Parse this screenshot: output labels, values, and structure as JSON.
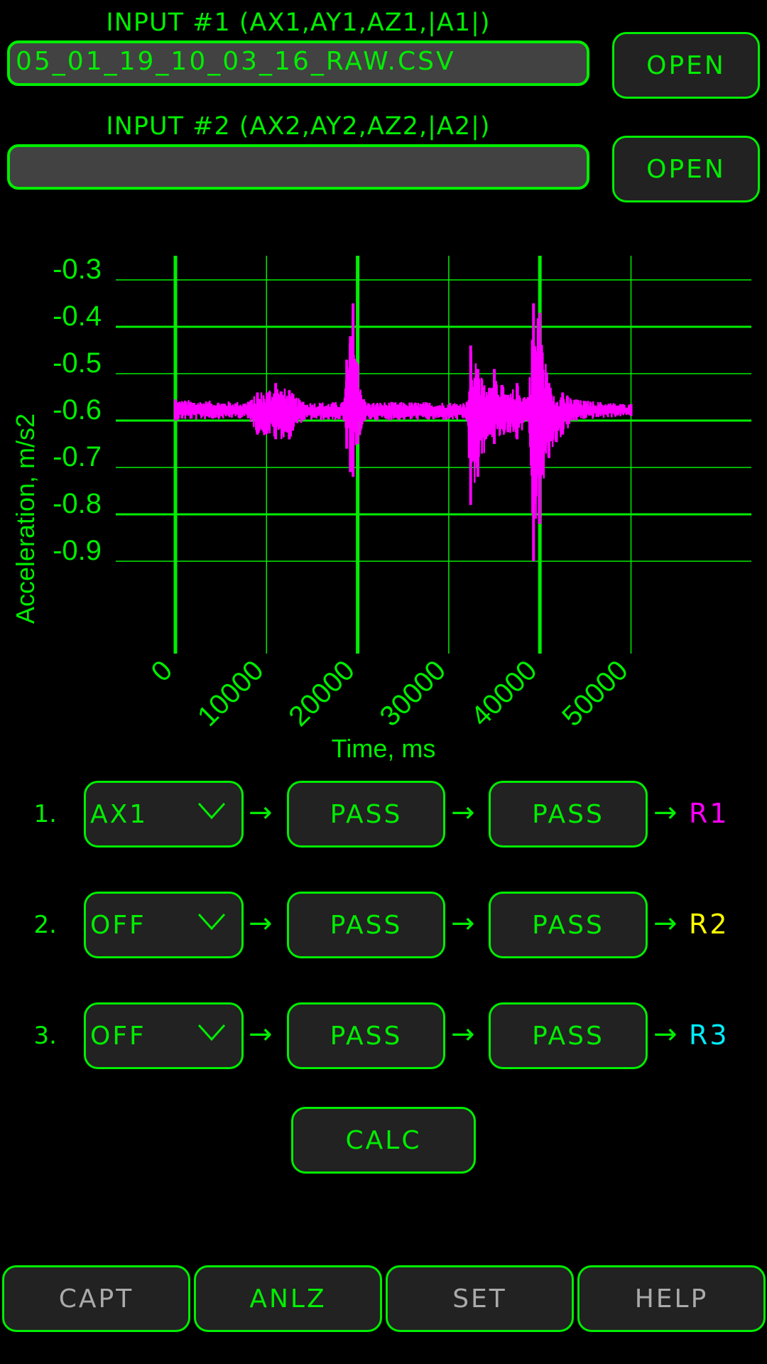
{
  "inputs": [
    {
      "label": "INPUT #1 (AX1,AY1,AZ1,|A1|)",
      "value": "05_01_19_10_03_16_RAW.CSV",
      "placeholder": "",
      "open_label": "OPEN"
    },
    {
      "label": "INPUT #2 (AX2,AY2,AZ2,|A2|)",
      "value": "",
      "placeholder": "",
      "open_label": "OPEN"
    }
  ],
  "colors": {
    "accent": "#00ee00",
    "signal": "#ff00ff",
    "r1": "#ff00ff",
    "r2": "#ffff00",
    "r3": "#00eeff",
    "inactive_text": "#aaaaaa",
    "button_bg": "#222222",
    "field_bg": "#424242"
  },
  "chart_data": {
    "type": "line",
    "title": "",
    "xlabel": "Time, ms",
    "ylabel": "Acceleration, m/s2",
    "xlim": [
      0,
      55000
    ],
    "ylim": [
      -0.95,
      -0.275
    ],
    "x_ticks": [
      0,
      10000,
      20000,
      30000,
      40000,
      50000
    ],
    "x_tick_labels": [
      "0",
      "10000",
      "20000",
      "30000",
      "40000",
      "50000"
    ],
    "y_ticks": [
      -0.3,
      -0.4,
      -0.5,
      -0.6,
      -0.7,
      -0.8,
      -0.9
    ],
    "y_tick_labels": [
      "-0.3",
      "-0.4",
      "-0.5",
      "-0.6",
      "-0.7",
      "-0.8",
      "-0.9"
    ],
    "grid": true,
    "series": [
      {
        "name": "AX1",
        "baseline": -0.575,
        "x_end": 50000,
        "envelope": [
          {
            "x": 0,
            "max": -0.555,
            "min": -0.6
          },
          {
            "x": 8000,
            "max": -0.56,
            "min": -0.595
          },
          {
            "x": 9000,
            "max": -0.54,
            "min": -0.63
          },
          {
            "x": 11000,
            "max": -0.52,
            "min": -0.64
          },
          {
            "x": 12500,
            "max": -0.535,
            "min": -0.64
          },
          {
            "x": 14000,
            "max": -0.56,
            "min": -0.6
          },
          {
            "x": 18500,
            "max": -0.56,
            "min": -0.6
          },
          {
            "x": 18800,
            "max": -0.47,
            "min": -0.66
          },
          {
            "x": 19200,
            "max": -0.42,
            "min": -0.71
          },
          {
            "x": 19500,
            "max": -0.35,
            "min": -0.72
          },
          {
            "x": 20000,
            "max": -0.48,
            "min": -0.65
          },
          {
            "x": 20800,
            "max": -0.56,
            "min": -0.6
          },
          {
            "x": 32000,
            "max": -0.56,
            "min": -0.6
          },
          {
            "x": 32400,
            "max": -0.44,
            "min": -0.78
          },
          {
            "x": 33200,
            "max": -0.49,
            "min": -0.72
          },
          {
            "x": 34500,
            "max": -0.53,
            "min": -0.63
          },
          {
            "x": 35000,
            "max": -0.49,
            "min": -0.65
          },
          {
            "x": 36500,
            "max": -0.545,
            "min": -0.625
          },
          {
            "x": 37500,
            "max": -0.52,
            "min": -0.64
          },
          {
            "x": 38700,
            "max": -0.55,
            "min": -0.6
          },
          {
            "x": 39300,
            "max": -0.35,
            "min": -0.9
          },
          {
            "x": 40000,
            "max": -0.37,
            "min": -0.82
          },
          {
            "x": 41000,
            "max": -0.52,
            "min": -0.68
          },
          {
            "x": 42500,
            "max": -0.54,
            "min": -0.63
          },
          {
            "x": 44000,
            "max": -0.555,
            "min": -0.6
          },
          {
            "x": 50000,
            "max": -0.565,
            "min": -0.59
          }
        ]
      }
    ]
  },
  "pipelines": [
    {
      "index": "1.",
      "source": "AX1",
      "stage1": "PASS",
      "stage2": "PASS",
      "result": "R1",
      "arrow": "→"
    },
    {
      "index": "2.",
      "source": "OFF",
      "stage1": "PASS",
      "stage2": "PASS",
      "result": "R2",
      "arrow": "→"
    },
    {
      "index": "3.",
      "source": "OFF",
      "stage1": "PASS",
      "stage2": "PASS",
      "result": "R3",
      "arrow": "→"
    }
  ],
  "calc_label": "CALC",
  "nav": {
    "active": "ANLZ",
    "items": [
      {
        "label": "CAPT"
      },
      {
        "label": "ANLZ"
      },
      {
        "label": "SET"
      },
      {
        "label": "HELP"
      }
    ]
  }
}
